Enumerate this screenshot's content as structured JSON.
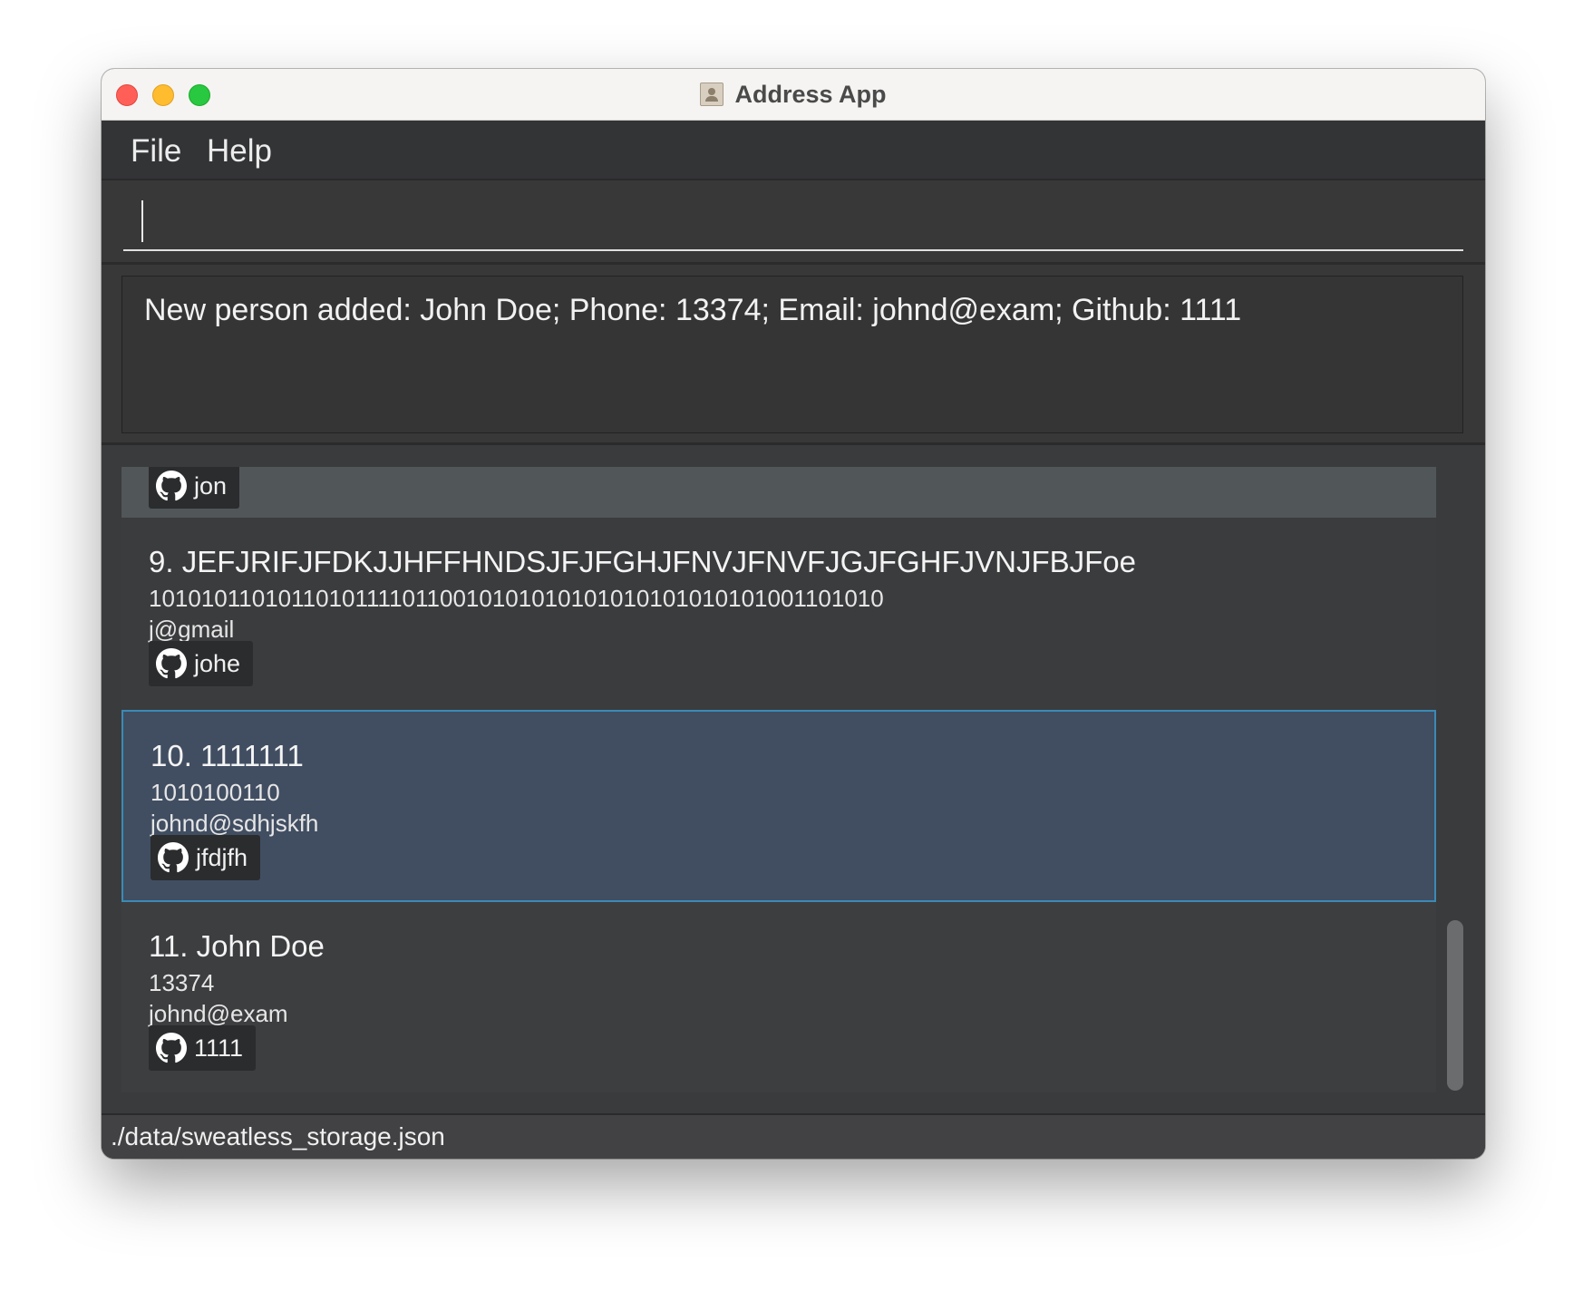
{
  "window": {
    "title": "Address App"
  },
  "menu": {
    "items": [
      "File",
      "Help"
    ]
  },
  "command": {
    "value": ""
  },
  "result": {
    "message": "New person added: John Doe; Phone: 13374; Email: johnd@exam; Github: 1111"
  },
  "persons": [
    {
      "index_name": "",
      "phone": "",
      "email": "",
      "github": "jon",
      "icon": "github-icon"
    },
    {
      "index_name": "9. JEFJRIFJFDKJJHFFHNDSJFJFGHJFNVJFNVFJGJFGHFJVNJFBJFoe",
      "phone": "101010110101101011110110010101010101010101010101001101010",
      "email": "j@gmail",
      "github": "johe",
      "icon": "github-icon"
    },
    {
      "index_name": "10. 1111111",
      "phone": "1010100110",
      "email": "johnd@sdhjskfh",
      "github": "jfdjfh",
      "icon": "github-icon",
      "selected": true
    },
    {
      "index_name": "11. John Doe",
      "phone": "13374",
      "email": "johnd@exam",
      "github": "1111",
      "icon": "github-icon"
    }
  ],
  "status": {
    "path": "./data/sweatless_storage.json"
  },
  "colors": {
    "selected_card": "#414e62",
    "selected_border": "#3b8ab5",
    "background": "#3a3b3d"
  }
}
